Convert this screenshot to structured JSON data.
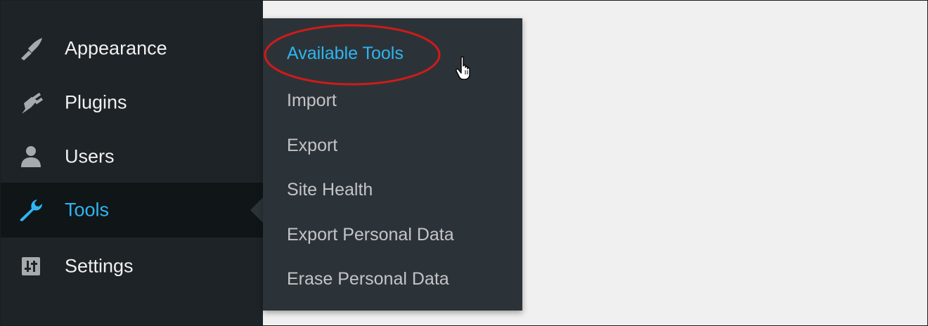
{
  "sidebar": {
    "items": [
      {
        "label": "Appearance",
        "icon": "paintbrush-icon"
      },
      {
        "label": "Plugins",
        "icon": "plug-icon"
      },
      {
        "label": "Users",
        "icon": "user-icon"
      },
      {
        "label": "Tools",
        "icon": "wrench-icon",
        "active": true
      },
      {
        "label": "Settings",
        "icon": "sliders-icon"
      }
    ]
  },
  "submenu": {
    "items": [
      {
        "label": "Available Tools",
        "current": true
      },
      {
        "label": "Import"
      },
      {
        "label": "Export"
      },
      {
        "label": "Site Health"
      },
      {
        "label": "Export Personal Data"
      },
      {
        "label": "Erase Personal Data"
      }
    ]
  },
  "colors": {
    "sidebar_bg": "#1d2327",
    "submenu_bg": "#2c3338",
    "active_bg": "#101517",
    "accent": "#2fb5f0",
    "annotation": "#d11a1a",
    "content_bg": "#f0f0f1"
  }
}
